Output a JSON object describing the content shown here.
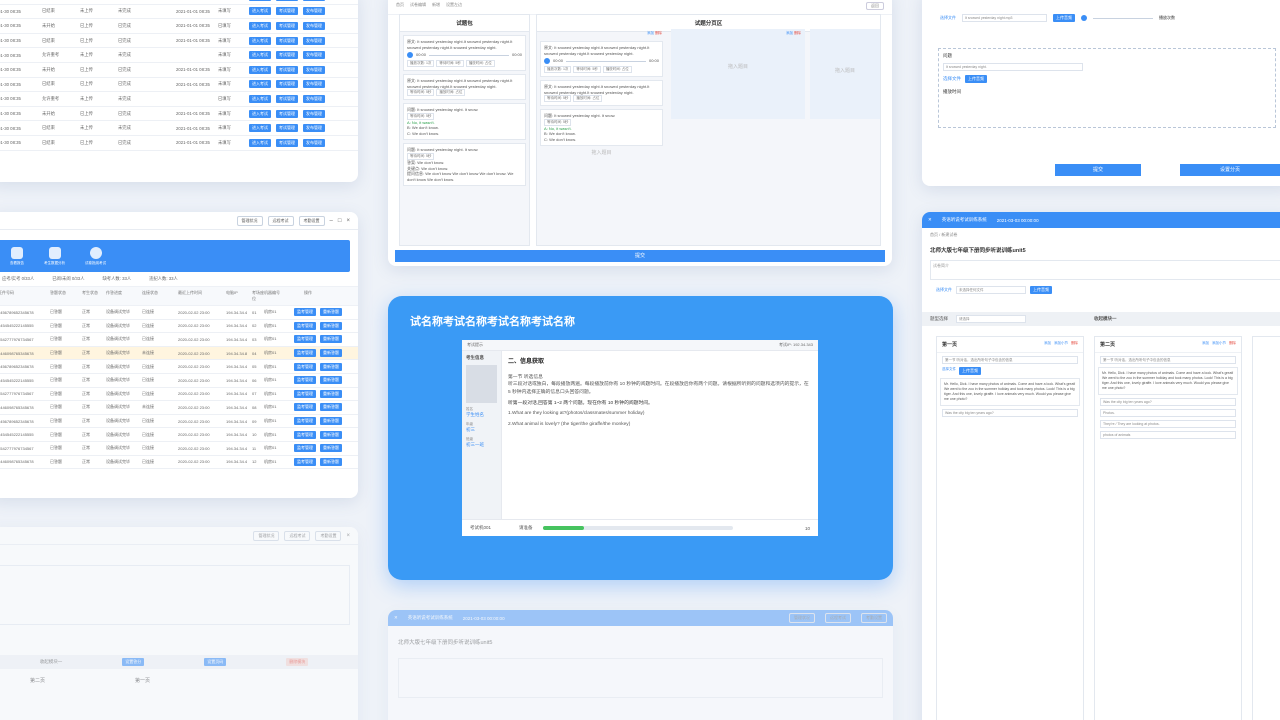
{
  "top_table": {
    "rows": [
      [
        "01-30 08:35",
        "已结束",
        "已上传",
        "已完成",
        "2021-01-01 08:35",
        "未填写"
      ],
      [
        "01-30 08:35",
        "已结束",
        "未上传",
        "未完成",
        "2021-01-01 08:35",
        "未填写"
      ],
      [
        "01-30 08:35",
        "未开始",
        "已上传",
        "已完成",
        "2021-01-01 08:35",
        "已填写"
      ],
      [
        "01-30 08:35",
        "已结束",
        "已上传",
        "已完成",
        "2021-01-01 08:35",
        "未填写"
      ],
      [
        "01-30 08:35",
        "允许重考",
        "未上传",
        "未完成",
        "",
        "未填写"
      ],
      [
        "01-30 08:35",
        "未开始",
        "已上传",
        "已完成",
        "2021-01-01 08:35",
        "未填写"
      ],
      [
        "01-30 08:35",
        "已结束",
        "已上传",
        "已完成",
        "2021-01-01 08:35",
        "未填写"
      ],
      [
        "01-30 08:35",
        "允许重考",
        "未上传",
        "未完成",
        "",
        "已填写"
      ],
      [
        "01-30 08:35",
        "未开始",
        "已上传",
        "已完成",
        "2021-01-01 08:35",
        "未填写"
      ],
      [
        "01-30 08:35",
        "已结束",
        "未上传",
        "未完成",
        "2021-01-01 08:35",
        "未填写"
      ],
      [
        "01-30 08:35",
        "已结束",
        "已上传",
        "已完成",
        "2021-01-01 08:35",
        "未填写"
      ]
    ],
    "btns": [
      "进入考试",
      "考试管理",
      "发布管理"
    ]
  },
  "mid_window": {
    "title_buttons": [
      "管理状况",
      "远程考试",
      "考勤设置"
    ],
    "banner": [
      "查看报告",
      "考生数据分析",
      "试卷批阅考试"
    ],
    "stats": [
      "应考/实考 0/33人",
      "已阅/未阅 0/33人",
      "缺考人数: 33人",
      "违纪人数: 33人"
    ],
    "headers": [
      "证件号码",
      "答题状态",
      "考生状态",
      "作答进度",
      "连接状态",
      "最近上传时间",
      "电脑IP",
      "考场座位",
      "机器编号",
      "操作"
    ],
    "rows": [
      [
        "3456789652345678",
        "已答题",
        "正常",
        "设备调试完毕",
        "已连接",
        "2020-02-02 23:00",
        "194.34.34.4",
        "01",
        "机房01"
      ],
      [
        "4454545222145555",
        "已答题",
        "正常",
        "设备调试完毕",
        "已连接",
        "2020-02-02 23:00",
        "194.34.34.4",
        "02",
        "机房01"
      ],
      [
        "4542777976734567",
        "已答题",
        "正常",
        "设备调试完毕",
        "已连接",
        "2020-02-02 23:00",
        "194.34.34.4",
        "03",
        "机房01"
      ],
      [
        "3446098765345678",
        "已答题",
        "正常",
        "设备调试完毕",
        "未连接",
        "2020-02-02 23:00",
        "194.34.34.8",
        "04",
        "机房01"
      ],
      [
        "3456789652345678",
        "已答题",
        "正常",
        "设备调试完毕",
        "已连接",
        "2020-02-02 23:00",
        "194.34.34.4",
        "05",
        "机房01"
      ],
      [
        "4454545222145555",
        "已答题",
        "正常",
        "设备调试完毕",
        "已连接",
        "2020-02-02 23:00",
        "194.34.34.4",
        "06",
        "机房01"
      ],
      [
        "4542777976734567",
        "已答题",
        "正常",
        "设备调试完毕",
        "已连接",
        "2020-02-02 23:00",
        "194.34.34.4",
        "07",
        "机房01"
      ],
      [
        "3446098765345678",
        "已答题",
        "正常",
        "设备调试完毕",
        "未连接",
        "2020-02-02 23:00",
        "194.34.34.4",
        "08",
        "机房01"
      ],
      [
        "3456789652345678",
        "已答题",
        "正常",
        "设备调试完毕",
        "已连接",
        "2020-02-02 23:00",
        "194.34.34.4",
        "09",
        "机房01"
      ],
      [
        "4454545222145555",
        "已答题",
        "正常",
        "设备调试完毕",
        "已连接",
        "2020-02-02 23:00",
        "194.34.34.4",
        "10",
        "机房01"
      ],
      [
        "4542777976734567",
        "已答题",
        "正常",
        "设备调试完毕",
        "已连接",
        "2020-02-02 23:00",
        "194.34.34.4",
        "11",
        "机房01"
      ],
      [
        "3446098765345678",
        "已答题",
        "正常",
        "设备调试完毕",
        "已连接",
        "2020-02-02 23:00",
        "194.34.34.4",
        "12",
        "机房01"
      ]
    ],
    "ops": [
      "监考管理",
      "重新答题"
    ]
  },
  "bot_window": {
    "module": "收起模块一",
    "page": "第二页",
    "page2": "第一页",
    "btns": [
      "设置答分",
      "设置页码",
      "删除模块"
    ]
  },
  "center_top": {
    "crumbs": [
      "首页",
      "试卷编辑",
      "新增",
      "设置左边"
    ],
    "ret": "返回",
    "pool_title": "试题包",
    "area_title": "试题分页区",
    "q1_label": "原文:",
    "q1_text": "It snowed yesterday night.It snowed yesterday night.It snowed yesterday night.It snowed yesterday night.",
    "time_a": "00:00",
    "time_b": "00:00",
    "q2_label": "原文:",
    "q2_text": "It snowed yesterday night.It snowed yesterday night.It snowed yesterday night.It snowed yesterday night.",
    "chips": [
      "播放次数: 1次",
      "等待时间: 5秒",
      "播放时间: 占位"
    ],
    "q3_q": "问题: It snowed yesterday night. It snow.",
    "q3_chip": "等待时间: 5秒",
    "q3_a": "A: No, it wasn't.",
    "q3_b": "B: We don't know.",
    "q3_c": "C: We don't know.",
    "q4_q": "问题: It snowed yesterday night. It snow.",
    "q4_ans": "答案: We don't know.",
    "q4_key": "关键点: We don't know.",
    "q4_info": "提问信息: We don't know We don't know We don't know. We don't know We don't know.",
    "add": "添加",
    "del": "删除",
    "drop": "拖入题目",
    "submit": "提交"
  },
  "center_main": {
    "title": "试名称考试名称考试名称考试名称",
    "top_left": "考试提示",
    "top_right": "考试IP: 192.34.343",
    "side_title": "考生信息",
    "side": [
      {
        "label": "姓名",
        "value": "学生姓名"
      },
      {
        "label": "年级",
        "value": "初三"
      },
      {
        "label": "班级",
        "value": "初三一班"
      }
    ],
    "section": "二、信息获取",
    "p1": "第一节 听选信息",
    "p2": "听三段对话或独白，每段播放两遍。每段播放前你有 10 秒钟的阅题时间。在段播放后你有两个问题。请根据所听到的问题和选项内的提示，在 5 秒钟内选择正确的信息口头回答问题。",
    "p3": "听第一段对话,回答第 1~2 两个问题。现在你有 10 秒钟的阅题时间。",
    "q1": "1.What are they looking at?(photos/classmates/summer holiday)",
    "q2": "2.What animal is lovely? (the tiger/the giraffe/the monkey)",
    "machine": "考试机001",
    "ready": "请准备",
    "progress": 0.22,
    "countdown": "10"
  },
  "center_bot": {
    "app": "英语听说考试训练系统",
    "time": "2021-03-03 00:00:00",
    "btns": [
      "管理状况",
      "远程考试",
      "考勤设置"
    ],
    "title": "北师大版七年级下册同步听说训练unit5"
  },
  "right_top": {
    "file": "It snowed yesterday night.mp3",
    "upload": "上传音频",
    "times": "播放次数",
    "q_label": "问题",
    "q_text": "It snowed yesterday night.",
    "choose": "选择文件",
    "wait": "播放时间",
    "submit": "提交",
    "setpage": "设置分页"
  },
  "right_main": {
    "app": "英语听说考试训练系统",
    "time": "2021-03-03 00:00:00",
    "crumbs": "首页 / 新建试卷",
    "title": "北师大版七年级下册同步听说训练unit5",
    "desc_ph": "试卷简介",
    "choose": "选择文件",
    "no_file": "未选择任何文件",
    "upload": "上传音频",
    "type_label": "题型选择",
    "type_val": "请选择",
    "module": "收起模块一",
    "col1": "第一页",
    "col2": "第二页",
    "add": "添加",
    "add_small": "添加小节",
    "del": "删除",
    "intro": "第一节 听对话，选出所听句子中包含的信息",
    "hello": "Mr. Hello, Dick. I have many photos of animals. Come and have a look. What's great! We went to the zoo in the summer holiday and took many photos. Look! This is a big tiger. And this one, lovely giraffe. I love animals very much. Would you please give me one photo?",
    "q_city": "Was the city big ten years ago?",
    "ans1": "Photos.",
    "ans2": "They're / They are looking at photos.",
    "ans3": "photos of animals"
  }
}
